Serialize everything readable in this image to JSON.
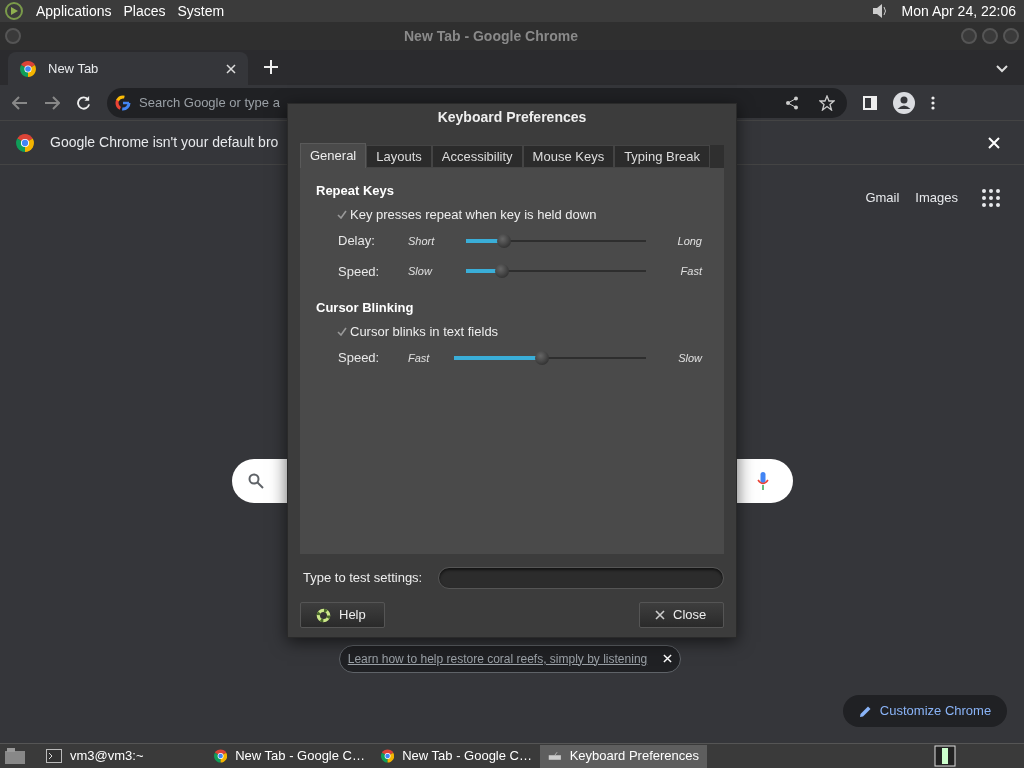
{
  "top_panel": {
    "menus": [
      "Applications",
      "Places",
      "System"
    ],
    "clock": "Mon Apr 24, 22:06"
  },
  "window": {
    "title": "New Tab - Google Chrome"
  },
  "tabs": [
    {
      "label": "New Tab",
      "selected": true
    }
  ],
  "omnibox": {
    "placeholder": "Search Google or type a"
  },
  "infobar": {
    "text": "Google Chrome isn't your default bro"
  },
  "ntp_links": [
    "Gmail",
    "Images"
  ],
  "promo": {
    "text": "Learn how to help restore coral reefs, simply by listening"
  },
  "customize_button": "Customize Chrome",
  "dialog": {
    "title": "Keyboard Preferences",
    "tabs": [
      {
        "label": "General",
        "selected": true
      },
      {
        "label": "Layouts",
        "selected": false
      },
      {
        "label": "Accessibility",
        "selected": false
      },
      {
        "label": "Mouse Keys",
        "selected": false
      },
      {
        "label": "Typing Break",
        "selected": false
      }
    ],
    "sections": [
      {
        "heading": "Repeat Keys",
        "checkbox": {
          "label": "Key presses repeat when key is held down",
          "checked": true
        },
        "sliders": [
          {
            "label": "Delay:",
            "min": "Short",
            "max": "Long",
            "level": 0.21
          },
          {
            "label": "Speed:",
            "min": "Slow",
            "max": "Fast",
            "level": 0.2
          }
        ]
      },
      {
        "heading": "Cursor Blinking",
        "checkbox": {
          "label": "Cursor blinks in text fields",
          "checked": true
        },
        "sliders": [
          {
            "label": "Speed:",
            "min": "Fast",
            "max": "Slow",
            "level": 0.46
          }
        ]
      }
    ],
    "test_label": "Type to test settings:",
    "buttons": [
      {
        "label": "Help",
        "kind": "help"
      },
      {
        "label": "Close",
        "kind": "close"
      }
    ]
  },
  "taskbar": [
    {
      "label": "vm3@vm3:~",
      "kind": "terminal",
      "selected": false
    },
    {
      "label": "New Tab - Google C…",
      "kind": "chrome",
      "selected": false
    },
    {
      "label": "New Tab - Google C…",
      "kind": "chrome",
      "selected": false
    },
    {
      "label": "Keyboard Preferences",
      "kind": "keyboard",
      "selected": true
    }
  ]
}
